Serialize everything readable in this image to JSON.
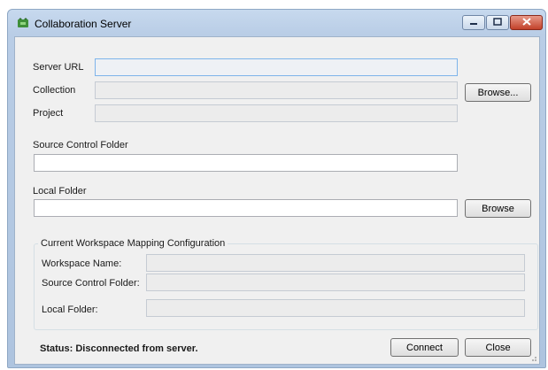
{
  "window": {
    "title": "Collaboration Server"
  },
  "form": {
    "server_url_label": "Server URL",
    "server_url_value": "",
    "collection_label": "Collection",
    "collection_value": "",
    "project_label": "Project",
    "project_value": "",
    "browse_collection_label": "Browse...",
    "source_control_folder_label": "Source Control Folder",
    "source_control_folder_value": "",
    "local_folder_label": "Local Folder",
    "local_folder_value": "",
    "browse_local_label": "Browse"
  },
  "mapping": {
    "group_title": "Current Workspace Mapping Configuration",
    "workspace_name_label": "Workspace Name:",
    "workspace_name_value": "",
    "source_control_folder_label": "Source Control Folder:",
    "source_control_folder_value": "",
    "local_folder_label": "Local Folder:",
    "local_folder_value": ""
  },
  "footer": {
    "status_text": "Status: Disconnected from server.",
    "connect_label": "Connect",
    "close_label": "Close"
  },
  "icons": {
    "app": "app-icon",
    "minimize": "minimize-icon",
    "maximize": "maximize-icon",
    "close": "close-icon"
  },
  "colors": {
    "title_bar": "#b9cde6",
    "close_button": "#c2412a",
    "client_background": "#f0f0f0"
  }
}
